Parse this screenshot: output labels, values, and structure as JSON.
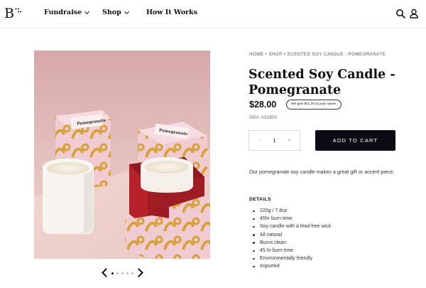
{
  "header": {
    "logo_letter": "B",
    "logo_mark": "::\n·:",
    "nav": [
      {
        "label": "Fundraise",
        "icon": "chevron-down-icon"
      },
      {
        "label": "Shop",
        "icon": "chevron-down-icon"
      },
      {
        "label": "How It Works"
      }
    ],
    "icons": [
      "search-icon",
      "user-icon"
    ]
  },
  "breadcrumb": {
    "items": [
      "HOME",
      "SHOP",
      "SCENTED SOY CANDLE - POMEGRANATE"
    ],
    "separator": "•"
  },
  "product": {
    "title": "Scented Soy Candle - Pomegranate",
    "price": "$28.00",
    "give_badge": "We give $11.20 to your cause.",
    "sku": "SKU: #31903",
    "quantity": "1",
    "qty_minus": "-",
    "qty_plus": "+",
    "add_to_cart": "ADD TO CART",
    "description": "Our pomegranate soy candle makes a great gift or accent piece.",
    "details_title": "DETAILS",
    "details": [
      "220g / 7.8oz",
      "45hr burn time",
      "Soy candle with a lead-free wick",
      "All natural",
      "Burns clean",
      "45 hr burn time",
      "Environmentally friendly",
      "Imported"
    ],
    "box_label": "Pomegranate"
  },
  "carousel": {
    "total": 5,
    "active": 1
  },
  "colors": {
    "accent": "#0b0b14",
    "image_bg": "#e2bfbf",
    "box_red": "#b8202a",
    "box_pink": "#f1cbd2",
    "box_gold": "#d7a238"
  }
}
